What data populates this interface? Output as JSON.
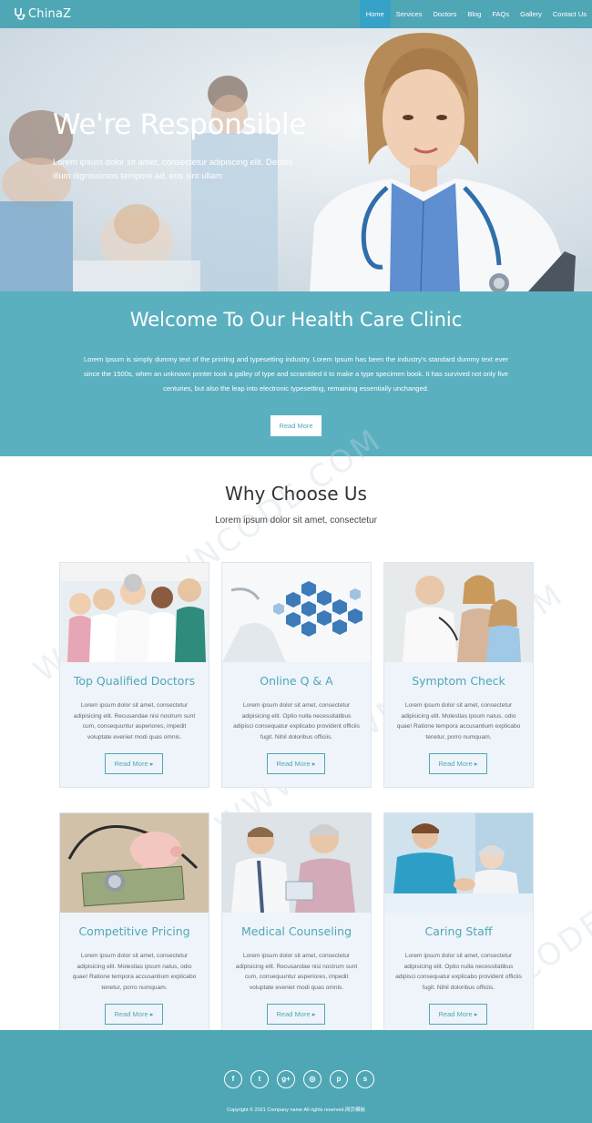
{
  "nav": {
    "brand": "ChinaZ",
    "items": [
      {
        "label": "Home",
        "active": true
      },
      {
        "label": "Services"
      },
      {
        "label": "Doctors"
      },
      {
        "label": "Blog"
      },
      {
        "label": "FAQs"
      },
      {
        "label": "Gallery"
      },
      {
        "label": "Contact Us"
      }
    ]
  },
  "hero": {
    "title": "We're Responsible",
    "text": "Lorem ipsum dolor sit amet, consectetur adipiscing elit. Debitis illum dignissimos tempore ad, eos sint ullam"
  },
  "welcome": {
    "title": "Welcome To Our Health Care Clinic",
    "text": "Lorem Ipsum is simply dummy text of the printing and typesetting industry. Lorem Ipsum has been the industry's standard dummy text ever since the 1500s, when an unknown printer took a galley of type and scrambled it to make a type specimen book. It has survived not only five centuries, but also the leap into electronic typesetting, remaining essentially unchanged.",
    "button": "Read More"
  },
  "why": {
    "title": "Why Choose Us",
    "subtitle": "Lorem ipsum dolor sit amet, consectetur"
  },
  "cards": [
    {
      "title": "Top Qualified Doctors",
      "text": "Lorem ipsum dolor sit amet, consectetur adipisicing elit. Recusandae nisi nostrum sunt cum, consequuntur asperiores, impedit voluptate eveniet modi quas omnis.",
      "button": "Read More"
    },
    {
      "title": "Online Q & A",
      "text": "Lorem ipsum dolor sit amet, consectetur adipisicing elit. Optio nulla necessitatibus adipisci consequatur explicabo provident officiis fugit. Nihil doloribus officiis.",
      "button": "Read More"
    },
    {
      "title": "Symptom Check",
      "text": "Lorem ipsum dolor sit amet, consectetur adipisicing elit. Molestias ipsum natus, odio quae! Ratione tempora accusantium explicabo tenetur, porro numquam.",
      "button": "Read More"
    },
    {
      "title": "Competitive Pricing",
      "text": "Lorem ipsum dolor sit amet, consectetur adipisicing elit. Molestias ipsum natus, odio quae! Ratione tempora accusantium explicabo tenetur, porro numquam.",
      "button": "Read More"
    },
    {
      "title": "Medical Counseling",
      "text": "Lorem ipsum dolor sit amet, consectetur adipisicing elit. Recusandae nisi nostrum sunt cum, consequuntur asperiores, impedit voluptate eveniet modi quas omnis.",
      "button": "Read More"
    },
    {
      "title": "Caring Staff",
      "text": "Lorem ipsum dolor sit amet, consectetur adipisicing elit. Optio nulla necessitatibus adipisci consequatur explicabo provident officiis fugit. Nihil doloribus officiis.",
      "button": "Read More"
    }
  ],
  "footer": {
    "socials": [
      "facebook-icon",
      "twitter-icon",
      "google-plus-icon",
      "instagram-icon",
      "pinterest-icon",
      "skype-icon"
    ],
    "social_glyphs": [
      "f",
      "t",
      "g+",
      "◎",
      "p",
      "s"
    ],
    "copyright": "Copyright © 2021 Company name All rights reserved.网页模板"
  },
  "watermark": "WWW.DOWNCODE.COM",
  "colors": {
    "accent": "#4fa7b6",
    "nav_active": "#37a2c7",
    "welcome_bg": "#5ab0bf",
    "card_bg": "#eef4fa"
  }
}
